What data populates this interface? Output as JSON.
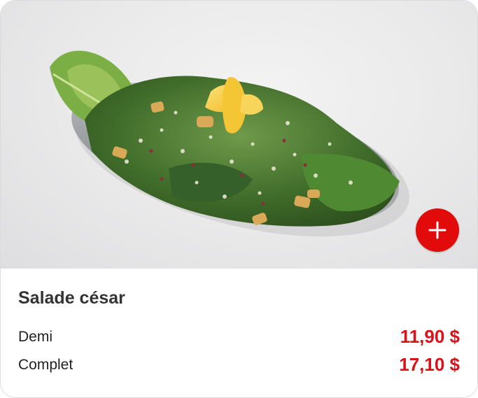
{
  "item": {
    "image_alt": "Salade césar",
    "title": "Salade césar",
    "add_icon": "plus-icon",
    "prices": [
      {
        "label": "Demi",
        "price": "11,90 $"
      },
      {
        "label": "Complet",
        "price": "17,10 $"
      }
    ]
  },
  "colors": {
    "accent": "#e10b0b",
    "price": "#d8121b",
    "title": "#333333",
    "text": "#222222"
  }
}
